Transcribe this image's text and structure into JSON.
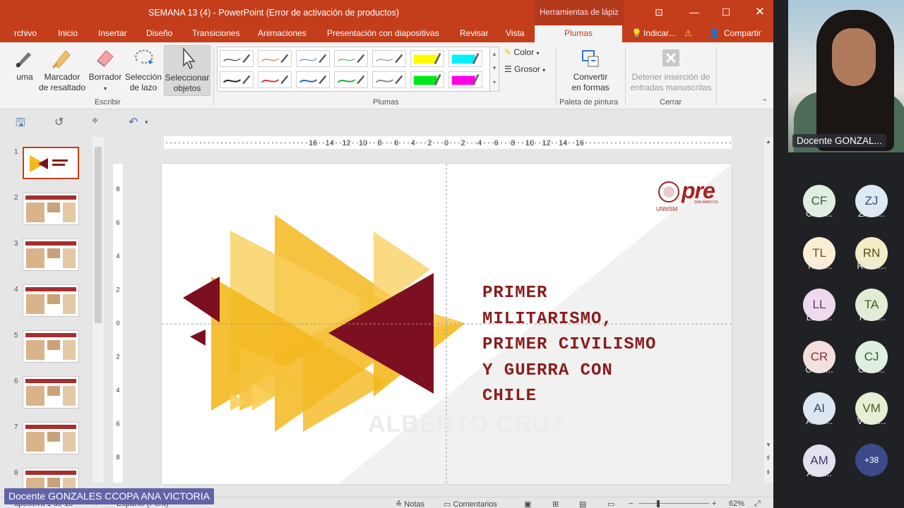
{
  "window": {
    "title": "SEMANA 13 (4) - PowerPoint (Error de activación de productos)",
    "context_tab": "Herramientas de lápiz"
  },
  "tabs": [
    "rchivo",
    "Inicio",
    "Insertar",
    "Diseño",
    "Transiciones",
    "Animaciones",
    "Presentación con diapositivas",
    "Revisar",
    "Vista",
    "Plumas"
  ],
  "tell_me": "Indicar...",
  "share": "Compartir",
  "ribbon": {
    "pluma": "uma",
    "marcador_1": "Marcador",
    "marcador_2": "de resaltado",
    "borrador": "Borrador",
    "lazo_1": "Selección",
    "lazo_2": "de lazo",
    "select_1": "Seleccionar",
    "select_2": "objetos",
    "group_escribir": "Escribir",
    "group_plumas": "Plumas",
    "color": "Color",
    "grosor": "Grosor",
    "convertir_1": "Convertir",
    "convertir_2": "en formas",
    "group_paleta": "Paleta de pintura",
    "detener_1": "Detener inserción de",
    "detener_2": "entradas manuscritas",
    "group_cerrar": "Cerrar",
    "pen_colors": [
      "#333333",
      "#e05a5a",
      "#5a86c0",
      "#4caa5e",
      "#8a8a8a",
      "#fffb00",
      "#00f0ff",
      "#222222",
      "#d33434",
      "#2e5fa8",
      "#27a34a",
      "#888888",
      "#00e81c",
      "#ff00e6"
    ]
  },
  "ruler": {
    "h_ticks": [
      "16",
      "14",
      "12",
      "10",
      "8",
      "6",
      "4",
      "2",
      "0",
      "2",
      "4",
      "6",
      "8",
      "10",
      "12",
      "14",
      "16"
    ],
    "v_ticks": [
      "8",
      "6",
      "4",
      "2",
      "0",
      "2",
      "4",
      "6",
      "8"
    ]
  },
  "thumbnails": [
    "1",
    "2",
    "3",
    "4",
    "5",
    "6",
    "7",
    "8"
  ],
  "slide": {
    "title_lines": [
      "PRIMER",
      "MILITARISMO,",
      "PRIMER CIVILISMO",
      "Y GUERRA CON",
      "CHILE"
    ],
    "watermark": "ALBERTO CRUZ",
    "logo_text": "pre",
    "logo_sub": "SAN MARCOS",
    "logo_unmsm": "UNMSM",
    "colors": {
      "gold": "#f4b820",
      "gold_light": "#f8cf5a",
      "maroon": "#7d1020"
    }
  },
  "status": {
    "slide_info": "apositiva 1 de 15",
    "lang": "Español (Perú)",
    "notas": "Notas",
    "comentarios": "Comentarios",
    "zoom": "62%"
  },
  "presenter_label": "Docente GONZALES CCOPA ANA VICTORIA",
  "video_label": "Docente GONZAL...",
  "participants": [
    {
      "initials": "CF",
      "name": "CAR...",
      "bg": "#dfeee0",
      "fg": "#3b5b3c"
    },
    {
      "initials": "ZJ",
      "name": "ZAM...",
      "bg": "#dde9f5",
      "fg": "#33496b"
    },
    {
      "initials": "TL",
      "name": "Tuto...",
      "bg": "#fbeed6",
      "fg": "#6b5222"
    },
    {
      "initials": "RN",
      "name": "RUA ...",
      "bg": "#f3ecc9",
      "fg": "#5c4e14"
    },
    {
      "initials": "LL",
      "name": "LEO...",
      "bg": "#efd9ee",
      "fg": "#673963"
    },
    {
      "initials": "TA",
      "name": "TRIL...",
      "bg": "#e0ecd3",
      "fg": "#3f5a29"
    },
    {
      "initials": "CR",
      "name": "CON...",
      "bg": "#f5dede",
      "fg": "#7a3838"
    },
    {
      "initials": "CJ",
      "name": "CAN...",
      "bg": "#dff0e0",
      "fg": "#2f5c35"
    },
    {
      "initials": "AI",
      "name": "ARA...",
      "bg": "#dde6f3",
      "fg": "#34486b"
    },
    {
      "initials": "VM",
      "name": "VIDA...",
      "bg": "#e5efd5",
      "fg": "#4a5d27"
    },
    {
      "initials": "AM",
      "name": "ALA...",
      "bg": "#e3e0f0",
      "fg": "#43396b"
    }
  ],
  "more_count": "+38"
}
